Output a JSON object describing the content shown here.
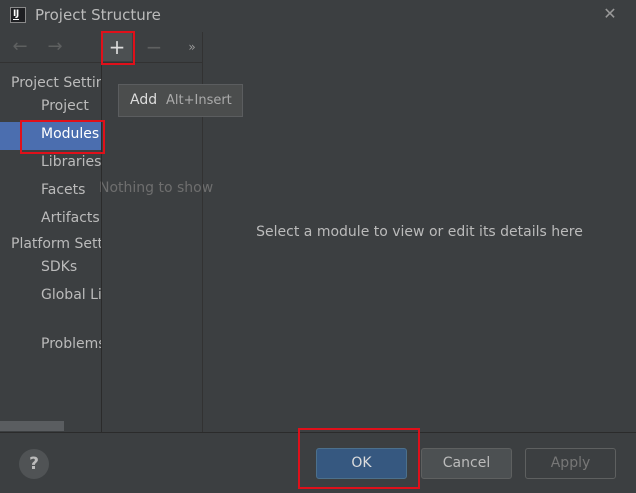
{
  "window": {
    "title": "Project Structure",
    "app_icon": "intellij-icon",
    "app_icon_text": "IJ",
    "close_glyph": "✕"
  },
  "toolbar": {
    "back_glyph": "←",
    "forward_glyph": "→",
    "add_glyph": "+",
    "remove_glyph": "−",
    "more_glyph": "»"
  },
  "sidebar": {
    "project_settings_heading": "Project Settin",
    "project_settings_items": [
      {
        "label": "Project",
        "selected": false
      },
      {
        "label": "Modules",
        "selected": true
      },
      {
        "label": "Libraries",
        "selected": false
      },
      {
        "label": "Facets",
        "selected": false
      },
      {
        "label": "Artifacts",
        "selected": false
      }
    ],
    "platform_settings_heading": "Platform Setti",
    "platform_settings_items": [
      {
        "label": "SDKs"
      },
      {
        "label": "Global Li"
      }
    ],
    "problems_label": "Problems"
  },
  "tooltip": {
    "text": "Add",
    "shortcut": "Alt+Insert"
  },
  "modules_list": {
    "empty_text": "Nothing to show"
  },
  "details": {
    "hint": "Select a module to view or edit its details here"
  },
  "footer": {
    "help_glyph": "?",
    "ok_label": "OK",
    "cancel_label": "Cancel",
    "apply_label": "Apply"
  },
  "colors": {
    "background": "#3c3f41",
    "selection": "#4b6eaf",
    "primary_button": "#365880",
    "highlight_box": "#e0101a"
  }
}
